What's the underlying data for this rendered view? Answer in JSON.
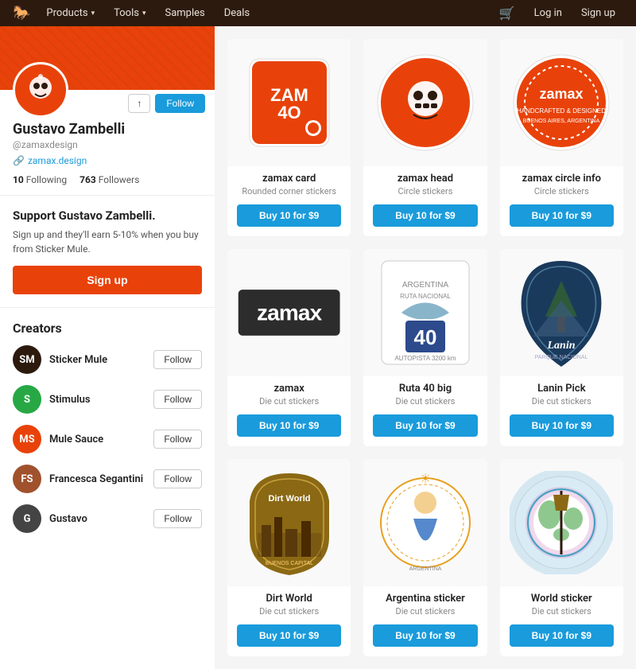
{
  "nav": {
    "logo": "🐎",
    "items": [
      {
        "label": "Products",
        "has_dropdown": true
      },
      {
        "label": "Tools",
        "has_dropdown": true
      },
      {
        "label": "Samples",
        "has_dropdown": false
      },
      {
        "label": "Deals",
        "has_dropdown": false
      }
    ],
    "cart_icon": "🛒",
    "login_label": "Log in",
    "signup_label": "Sign up"
  },
  "sidebar": {
    "profile": {
      "name": "Gustavo Zambelli",
      "handle": "@zamaxdesign",
      "website": "zamax.design",
      "following": "10",
      "followers": "763",
      "following_label": "Following",
      "followers_label": "Followers"
    },
    "actions": {
      "share_label": "↑",
      "follow_label": "Follow"
    },
    "support": {
      "title": "Support Gustavo Zambelli.",
      "text": "Sign up and they'll earn 5-10% when you buy from Sticker Mule.",
      "signup_label": "Sign up"
    },
    "creators": {
      "title": "Creators",
      "items": [
        {
          "name": "Sticker Mule",
          "avatar_bg": "#2c1a0e",
          "avatar_text": "SM",
          "follow_label": "Follow"
        },
        {
          "name": "Stimulus",
          "avatar_bg": "#27a844",
          "avatar_text": "S",
          "follow_label": "Follow"
        },
        {
          "name": "Mule Sauce",
          "avatar_bg": "#e8420a",
          "avatar_text": "MS",
          "follow_label": "Follow"
        },
        {
          "name": "Francesca Segantini",
          "avatar_bg": "#a0522d",
          "avatar_text": "FS",
          "follow_label": "Follow"
        },
        {
          "name": "Gustavo",
          "avatar_bg": "#444",
          "avatar_text": "G",
          "follow_label": "Follow"
        }
      ]
    }
  },
  "products": [
    {
      "name": "zamax card",
      "type": "Rounded corner stickers",
      "buy_label": "Buy 10 for $9",
      "shape": "rounded_rect",
      "color": "#e8420a"
    },
    {
      "name": "zamax head",
      "type": "Circle stickers",
      "buy_label": "Buy 10 for $9",
      "shape": "circle",
      "color": "#e8420a"
    },
    {
      "name": "zamax circle info",
      "type": "Circle stickers",
      "buy_label": "Buy 10 for $9",
      "shape": "circle_info",
      "color": "#e8420a"
    },
    {
      "name": "zamax",
      "type": "Die cut stickers",
      "buy_label": "Buy 10 for $9",
      "shape": "diecut_text",
      "color": "#2c2c2c"
    },
    {
      "name": "Ruta 40 big",
      "type": "Die cut stickers",
      "buy_label": "Buy 10 for $9",
      "shape": "ruta40",
      "color": "#888"
    },
    {
      "name": "Lanin Pick",
      "type": "Die cut stickers",
      "buy_label": "Buy 10 for $9",
      "shape": "pick",
      "color": "#1a3a5c"
    },
    {
      "name": "Dirt World",
      "type": "Die cut stickers",
      "buy_label": "Buy 10 for $9",
      "shape": "badge_shield",
      "color": "#8b6914"
    },
    {
      "name": "Argentina sticker",
      "type": "Die cut stickers",
      "buy_label": "Buy 10 for $9",
      "shape": "argentina",
      "color": "#e8a020"
    },
    {
      "name": "World sticker",
      "type": "Die cut stickers",
      "buy_label": "Buy 10 for $9",
      "shape": "world",
      "color": "#30a0c0"
    }
  ]
}
